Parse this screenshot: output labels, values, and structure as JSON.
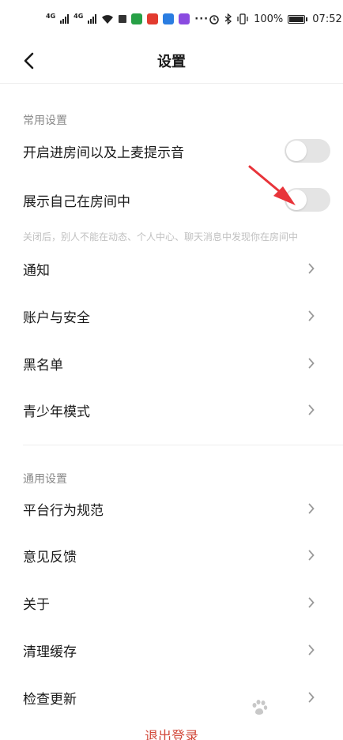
{
  "status_bar": {
    "network_1": "4G",
    "network_2": "4G",
    "overflow": "···",
    "battery_percent": "100%",
    "time": "07:52"
  },
  "nav": {
    "title": "设置",
    "back_icon": "chevron-left-icon"
  },
  "sections": {
    "common": {
      "title": "常用设置",
      "items": [
        {
          "label": "开启进房间以及上麦提示音",
          "control": "toggle",
          "on": false
        },
        {
          "label": "展示自己在房间中",
          "control": "toggle",
          "on": false
        }
      ],
      "hint": "关闭后，别人不能在动态、个人中心、聊天消息中发现你在房间中",
      "links": [
        {
          "label": "通知"
        },
        {
          "label": "账户与安全"
        },
        {
          "label": "黑名单"
        },
        {
          "label": "青少年模式"
        }
      ]
    },
    "general": {
      "title": "通用设置",
      "links": [
        {
          "label": "平台行为规范"
        },
        {
          "label": "意见反馈"
        },
        {
          "label": "关于"
        },
        {
          "label": "清理缓存"
        },
        {
          "label": "检查更新"
        }
      ]
    }
  },
  "logout_label": "退出登录",
  "colors": {
    "accent_red": "#d24b3c",
    "toggle_off": "#e4e4e4",
    "annotation_arrow": "#e8343a"
  }
}
